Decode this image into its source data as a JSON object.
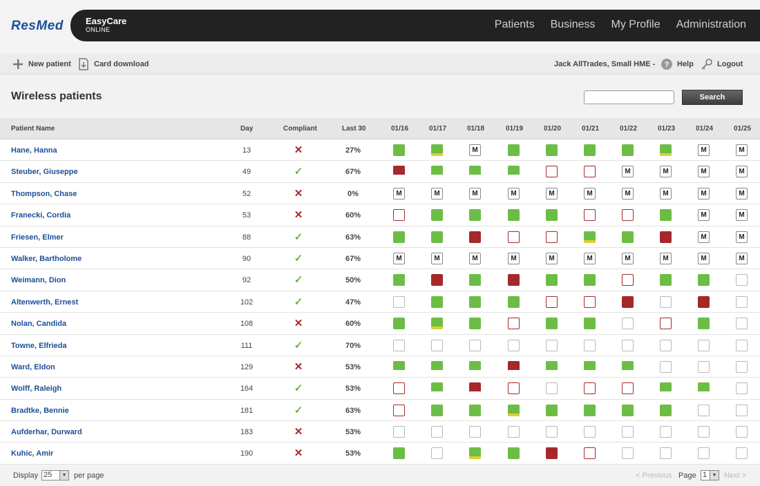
{
  "brand": {
    "logo": "ResMed",
    "product_name": "EasyCare",
    "product_sub": "ONLINE"
  },
  "nav": [
    "Patients",
    "Business",
    "My Profile",
    "Administration"
  ],
  "toolbar": {
    "new_patient": "New patient",
    "card_download": "Card download",
    "user": "Jack AllTrades, Small HME -",
    "help": "Help",
    "logout": "Logout"
  },
  "page_title": "Wireless patients",
  "search": {
    "value": "",
    "button": "Search"
  },
  "table": {
    "headers": {
      "name": "Patient Name",
      "day": "Day",
      "compliant": "Compliant",
      "last30": "Last 30",
      "dates": [
        "01/16",
        "01/17",
        "01/18",
        "01/19",
        "01/20",
        "01/21",
        "01/22",
        "01/23",
        "01/24",
        "01/25"
      ]
    },
    "rows": [
      {
        "name": "Hane, Hanna",
        "day": "13",
        "compliant": false,
        "last30": "27%",
        "days": [
          "g",
          "gy",
          "m",
          "g",
          "g",
          "g",
          "g",
          "gy",
          "m",
          "m"
        ]
      },
      {
        "name": "Steuber, Giuseppe",
        "day": "49",
        "compliant": true,
        "last30": "67%",
        "days": [
          "rw",
          "gw",
          "gw",
          "gw",
          "er",
          "er",
          "m",
          "m",
          "m",
          "m"
        ]
      },
      {
        "name": "Thompson, Chase",
        "day": "52",
        "compliant": false,
        "last30": "0%",
        "days": [
          "m",
          "m",
          "m",
          "m",
          "m",
          "m",
          "m",
          "m",
          "m",
          "m"
        ]
      },
      {
        "name": "Franecki, Cordia",
        "day": "53",
        "compliant": false,
        "last30": "60%",
        "days": [
          "er",
          "g",
          "g",
          "g",
          "g",
          "er",
          "er",
          "g",
          "m",
          "m"
        ]
      },
      {
        "name": "Friesen, Elmer",
        "day": "88",
        "compliant": true,
        "last30": "63%",
        "days": [
          "g",
          "g",
          "r",
          "er",
          "er",
          "gy",
          "g",
          "r",
          "m",
          "m"
        ]
      },
      {
        "name": "Walker, Bartholome",
        "day": "90",
        "compliant": true,
        "last30": "67%",
        "days": [
          "m",
          "m",
          "m",
          "m",
          "m",
          "m",
          "m",
          "m",
          "m",
          "m"
        ]
      },
      {
        "name": "Weimann, Dion",
        "day": "92",
        "compliant": true,
        "last30": "50%",
        "days": [
          "g",
          "r",
          "g",
          "r",
          "g",
          "g",
          "er",
          "g",
          "g",
          "e"
        ]
      },
      {
        "name": "Altenwerth, Ernest",
        "day": "102",
        "compliant": true,
        "last30": "47%",
        "days": [
          "e",
          "g",
          "g",
          "g",
          "er",
          "er",
          "r",
          "e",
          "r",
          "e"
        ]
      },
      {
        "name": "Nolan, Candida",
        "day": "108",
        "compliant": false,
        "last30": "60%",
        "days": [
          "g",
          "gy",
          "g",
          "er",
          "g",
          "g",
          "e",
          "er",
          "g",
          "e"
        ]
      },
      {
        "name": "Towne, Elfrieda",
        "day": "111",
        "compliant": true,
        "last30": "70%",
        "days": [
          "e",
          "e",
          "e",
          "e",
          "e",
          "e",
          "e",
          "e",
          "e",
          "e"
        ]
      },
      {
        "name": "Ward, Eldon",
        "day": "129",
        "compliant": false,
        "last30": "53%",
        "days": [
          "gw",
          "gw",
          "gw",
          "rw",
          "gw",
          "gw",
          "gw",
          "e",
          "e",
          "e"
        ]
      },
      {
        "name": "Wolff, Raleigh",
        "day": "164",
        "compliant": true,
        "last30": "53%",
        "days": [
          "er",
          "gw",
          "rw",
          "er",
          "e",
          "er",
          "er",
          "gw",
          "gw",
          "e"
        ]
      },
      {
        "name": "Bradtke, Bennie",
        "day": "181",
        "compliant": true,
        "last30": "63%",
        "days": [
          "er",
          "g",
          "g",
          "gy",
          "g",
          "g",
          "g",
          "g",
          "e",
          "e"
        ]
      },
      {
        "name": "Aufderhar, Durward",
        "day": "183",
        "compliant": false,
        "last30": "53%",
        "days": [
          "e",
          "e",
          "e",
          "e",
          "e",
          "e",
          "e",
          "e",
          "e",
          "e"
        ]
      },
      {
        "name": "Kuhic, Amir",
        "day": "190",
        "compliant": false,
        "last30": "53%",
        "days": [
          "g",
          "e",
          "gy",
          "g",
          "r",
          "er",
          "e",
          "e",
          "e",
          "e"
        ]
      }
    ],
    "marker_text": "M",
    "yes_glyph": "✓",
    "no_glyph": "✕"
  },
  "footer": {
    "display": "Display",
    "per_page_value": "25",
    "per_page": "per page",
    "previous": "< Previous",
    "page": "Page",
    "page_value": "1",
    "next": "Next >"
  },
  "colors": {
    "usage_green": "#6cbd45",
    "usage_red": "#a5282b",
    "partial_yellow": "#e2cf33",
    "link_blue": "#1c4f96"
  }
}
